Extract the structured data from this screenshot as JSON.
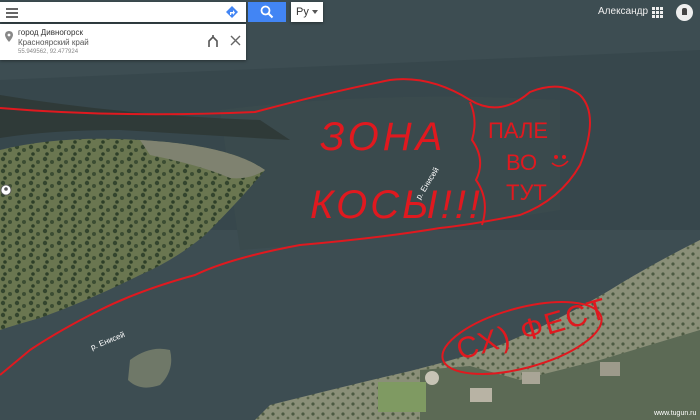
{
  "search": {
    "value": "",
    "placeholder": ""
  },
  "language": {
    "label": "Ру"
  },
  "user": {
    "name": "Александр"
  },
  "place": {
    "name": "город Дивногорск",
    "region": "Красноярский край",
    "coords": "55.949562, 92.477924"
  },
  "map": {
    "river_labels": [
      "р. Енисей",
      "р. Енисей"
    ],
    "annotations": {
      "zone_line1": "ЗОНА",
      "zone_line2": "КОСЫ!!!",
      "tent_line1": "ПАЛЕ",
      "tent_line2": "ВО",
      "tent_line3": "ТУТ",
      "fest": "СХ) ФЕСТ"
    },
    "annotation_color": "#e0191f"
  },
  "watermark": "www.tugun.ru",
  "icons": [
    "menu-icon",
    "directions-icon",
    "search-icon",
    "chevron-down-icon",
    "apps-grid-icon",
    "notifications-icon",
    "location-pin-icon",
    "route-icon",
    "close-icon",
    "smiley-icon"
  ]
}
